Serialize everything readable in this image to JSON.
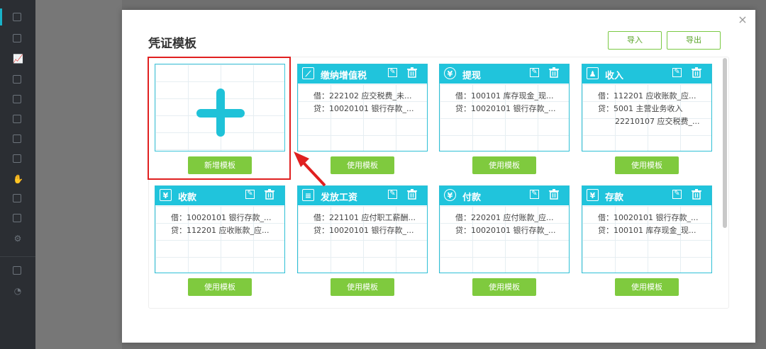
{
  "modal": {
    "title": "凭证模板",
    "close": "×",
    "import_label": "导入",
    "export_label": "导出"
  },
  "add_card": {
    "button_label": "新增模板"
  },
  "cards": [
    {
      "name": "缴纳增值税",
      "icon": "chart-line-icon",
      "lines": [
        "借：222102 应交税费_未...",
        "贷：10020101 银行存款_..."
      ],
      "button_label": "使用模板"
    },
    {
      "name": "提现",
      "icon": "yen-circle-icon",
      "lines": [
        "借：100101 库存现金_现...",
        "贷：10020101 银行存款_..."
      ],
      "button_label": "使用模板"
    },
    {
      "name": "收入",
      "icon": "user-money-icon",
      "lines": [
        "借：112201 应收账款_应...",
        "贷：5001 主营业务收入",
        "22210107 应交税费_..."
      ],
      "button_label": "使用模板"
    },
    {
      "name": "收款",
      "icon": "yen-box-icon",
      "lines": [
        "借：10020101 银行存款_...",
        "贷：112201 应收账款_应..."
      ],
      "button_label": "使用模板"
    },
    {
      "name": "发放工资",
      "icon": "payroll-icon",
      "lines": [
        "借：221101 应付职工薪酬...",
        "贷：10020101 银行存款_..."
      ],
      "button_label": "使用模板"
    },
    {
      "name": "付款",
      "icon": "payment-icon",
      "lines": [
        "借：220201 应付账款_应...",
        "贷：10020101 银行存款_..."
      ],
      "button_label": "使用模板"
    },
    {
      "name": "存款",
      "icon": "deposit-icon",
      "lines": [
        "借：10020101 银行存款_...",
        "贷：100101 库存现金_现..."
      ],
      "button_label": "使用模板"
    }
  ],
  "colors": {
    "accent": "#20c4dc",
    "button": "#7fca3e",
    "highlight": "#e02020"
  }
}
